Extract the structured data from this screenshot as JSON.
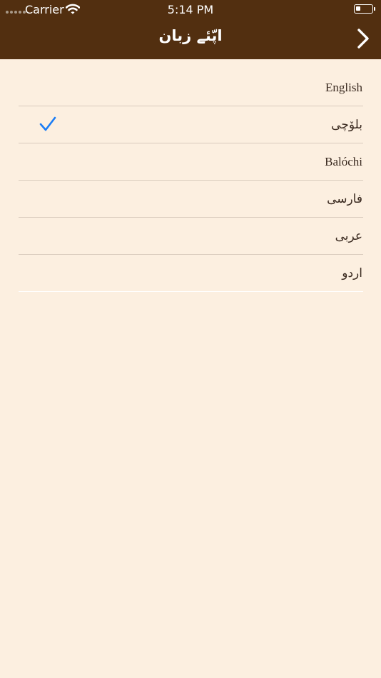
{
  "status_bar": {
    "carrier": "Carrier",
    "time": "5:14 PM",
    "battery_level_percent": 25
  },
  "nav": {
    "title": "اپّئے زبان",
    "forward_icon": "chevron-right-icon"
  },
  "languages": {
    "items": [
      {
        "label": "English",
        "selected": false
      },
      {
        "label": "بلۆچی",
        "selected": true
      },
      {
        "label": "Balóchi",
        "selected": false
      },
      {
        "label": "فارسی",
        "selected": false
      },
      {
        "label": "عربی",
        "selected": false
      },
      {
        "label": "اردو",
        "selected": false
      }
    ],
    "check_color": "#1a7cf5"
  },
  "colors": {
    "header": "#522f10",
    "background": "#fcefe0"
  }
}
